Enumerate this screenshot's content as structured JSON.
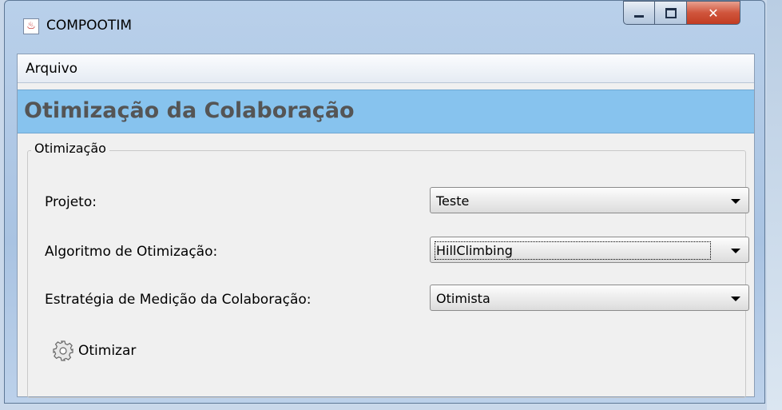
{
  "window": {
    "title": "COMPOOTIM"
  },
  "menu": {
    "items": [
      {
        "label": "Arquivo"
      }
    ]
  },
  "header": {
    "title": "Otimização da Colaboração"
  },
  "group": {
    "title": "Otimização",
    "fields": [
      {
        "label": "Projeto:",
        "value": "Teste"
      },
      {
        "label": "Algoritmo de Otimização:",
        "value": "HillClimbing"
      },
      {
        "label": "Estratégia de Medição da Colaboração:",
        "value": "Otimista"
      }
    ]
  },
  "actions": {
    "optimize_label": "Otimizar",
    "optimize_icon": "gear-icon"
  }
}
